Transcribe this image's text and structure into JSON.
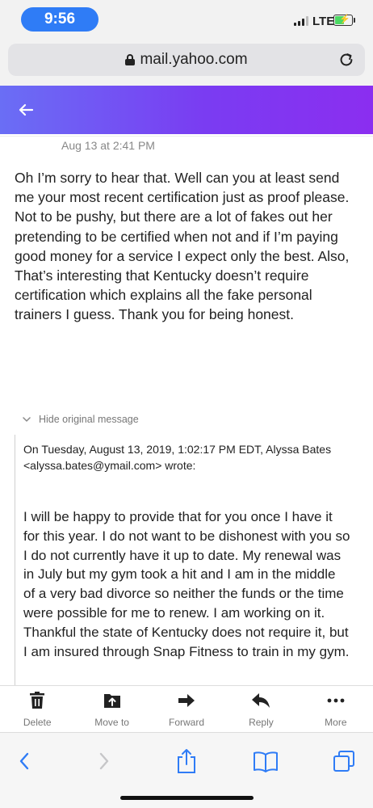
{
  "status_bar": {
    "time": "9:56",
    "network": "LTE"
  },
  "browser": {
    "url": "mail.yahoo.com"
  },
  "email": {
    "date": "Aug 13 at 2:41 PM",
    "body": "Oh I’m sorry to hear that. Well can you at least send me your most recent certification just as proof please. Not to be pushy, but there are a lot of fakes out her pretending to be certified when not and if I’m paying good money for a service I expect only the best. Also, That’s interesting that Kentucky doesn’t require certification which explains all the fake personal trainers I guess. Thank you for being honest.",
    "hide_original_label": "Hide original message",
    "quoted_header": "On Tuesday, August 13, 2019, 1:02:17 PM EDT, Alyssa Bates <alyssa.bates@ymail.com> wrote:",
    "quoted_body": "I will be happy to provide that for you once I have it for this year. I do not want to be dishonest with you so I do not currently have it up to date. My renewal was in July but my gym took a hit and I am in the middle of a very bad divorce so neither the funds or the time were possible for me to renew. I am working on it. Thankful the state of Kentucky does not require it, but I am insured through Snap Fitness to train in my gym."
  },
  "mail_toolbar": {
    "delete": "Delete",
    "move_to": "Move to",
    "forward": "Forward",
    "reply": "Reply",
    "more": "More"
  },
  "colors": {
    "header_gradient_start": "#6a6ef5",
    "header_gradient_end": "#8b2ef0",
    "ios_blue": "#2f7cf6"
  },
  "icons": [
    "lock-icon",
    "reload-icon",
    "back-arrow-icon",
    "trash-icon",
    "move-to-icon",
    "forward-icon",
    "reply-icon",
    "more-icon",
    "safari-back-icon",
    "safari-forward-icon",
    "share-icon",
    "bookmarks-icon",
    "tabs-icon"
  ]
}
